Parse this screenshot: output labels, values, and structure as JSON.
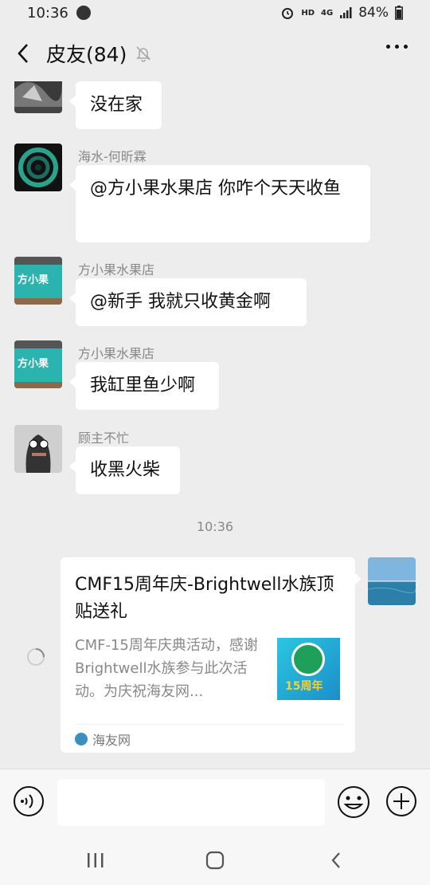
{
  "status": {
    "time": "10:36",
    "network": "HD",
    "signal_gen": "4G",
    "battery": "84%"
  },
  "header": {
    "title": "皮友(84)"
  },
  "messages": [
    {
      "sender": "",
      "text": "没在家"
    },
    {
      "sender": "海水-何昕霖",
      "text": "@方小果水果店  你咋个天天收鱼"
    },
    {
      "sender": "方小果水果店",
      "text": "@新手  我就只收黄金啊",
      "avatar_text": "方小果"
    },
    {
      "sender": "方小果水果店",
      "text": "我缸里鱼少啊",
      "avatar_text": "方小果"
    },
    {
      "sender": "顾主不忙",
      "text": "收黑火柴"
    }
  ],
  "timestamp": "10:36",
  "card": {
    "title": "CMF15周年庆-Brightwell水族顶贴送礼",
    "description": "CMF-15周年庆典活动，感谢Brightwell水族参与此次活动。为庆祝海友网...",
    "thumb_text": "15周年",
    "source": "海友网"
  },
  "input": {
    "value": ""
  },
  "colors": {
    "bubble": "#ffffff",
    "background": "#ededed",
    "teal": "#2bb3b0"
  }
}
